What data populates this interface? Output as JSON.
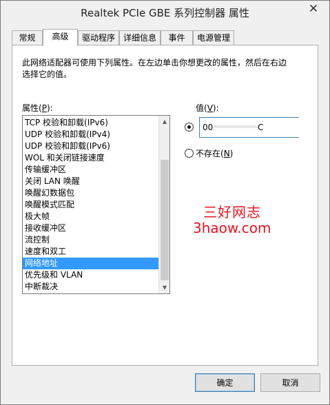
{
  "window": {
    "title": "Realtek PCIe GBE 系列控制器 属性",
    "close_label": "✕"
  },
  "tabs": [
    {
      "label": "常规"
    },
    {
      "label": "高级"
    },
    {
      "label": "驱动程序"
    },
    {
      "label": "详细信息"
    },
    {
      "label": "事件"
    },
    {
      "label": "电源管理"
    }
  ],
  "active_tab": "高级",
  "panel": {
    "description": "此网络适配器可使用下列属性。在左边单击你想更改的属性，然后在右边选择它的值。",
    "property_label": "属性(",
    "property_hotkey": "P",
    "property_label_end": "):",
    "value_label": "值(",
    "value_hotkey": "V",
    "value_label_end": "):",
    "not_present_label": "不存在(",
    "not_present_hotkey": "N",
    "not_present_label_end": ")",
    "value_prefix": "00",
    "value_suffix": "C",
    "selected_radio": "value"
  },
  "properties": [
    {
      "label": "TCP 校验和卸载(IPv6)"
    },
    {
      "label": "UDP 校验和卸载(IPv4)"
    },
    {
      "label": "UDP 校验和卸载(IPv6)"
    },
    {
      "label": "WOL 和关闭链接速度"
    },
    {
      "label": "传输缓冲区"
    },
    {
      "label": "关闭 LAN 唤醒"
    },
    {
      "label": "唤醒幻数据包"
    },
    {
      "label": "唤醒模式匹配"
    },
    {
      "label": "极大帧"
    },
    {
      "label": "接收缓冲区"
    },
    {
      "label": "流控制"
    },
    {
      "label": "速度和双工"
    },
    {
      "label": "网络地址"
    },
    {
      "label": "优先级和 VLAN"
    },
    {
      "label": "中断裁决"
    }
  ],
  "selected_property": "网络地址",
  "watermark": {
    "cn": "三好网志",
    "en": "3haow.com"
  },
  "buttons": {
    "ok": "确定",
    "cancel": "取消"
  },
  "colors": {
    "selection": "#3399ff",
    "watermark": "#e8121e",
    "focus_border": "#3c7fb1"
  }
}
